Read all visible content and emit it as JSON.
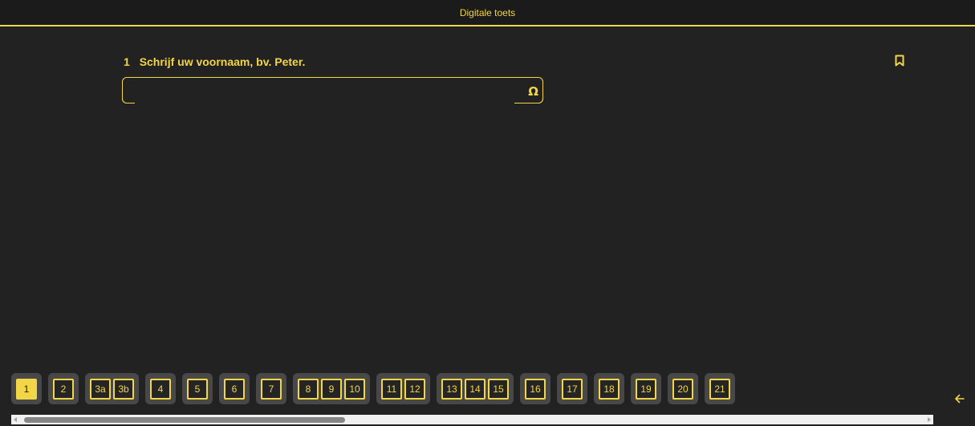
{
  "header": {
    "title": "Digitale toets"
  },
  "question": {
    "number": "1",
    "text": "Schrijf uw voornaam, bv. Peter.",
    "answer_value": "",
    "special_char_symbol": "Ω"
  },
  "icons": {
    "bookmark": "bookmark-icon",
    "special_chars": "omega-icon",
    "back": "arrow-left-icon"
  },
  "navigation": {
    "groups": [
      [
        "1"
      ],
      [
        "2"
      ],
      [
        "3a",
        "3b"
      ],
      [
        "4"
      ],
      [
        "5"
      ],
      [
        "6"
      ],
      [
        "7"
      ],
      [
        "8",
        "9",
        "10"
      ],
      [
        "11",
        "12"
      ],
      [
        "13",
        "14",
        "15"
      ],
      [
        "16"
      ],
      [
        "17"
      ],
      [
        "18"
      ],
      [
        "19"
      ],
      [
        "20"
      ],
      [
        "21"
      ]
    ],
    "active": "1"
  },
  "colors": {
    "accent": "#f3d548",
    "background": "#222222",
    "header_bg": "#1b1b1b",
    "group_bg": "#484848"
  }
}
